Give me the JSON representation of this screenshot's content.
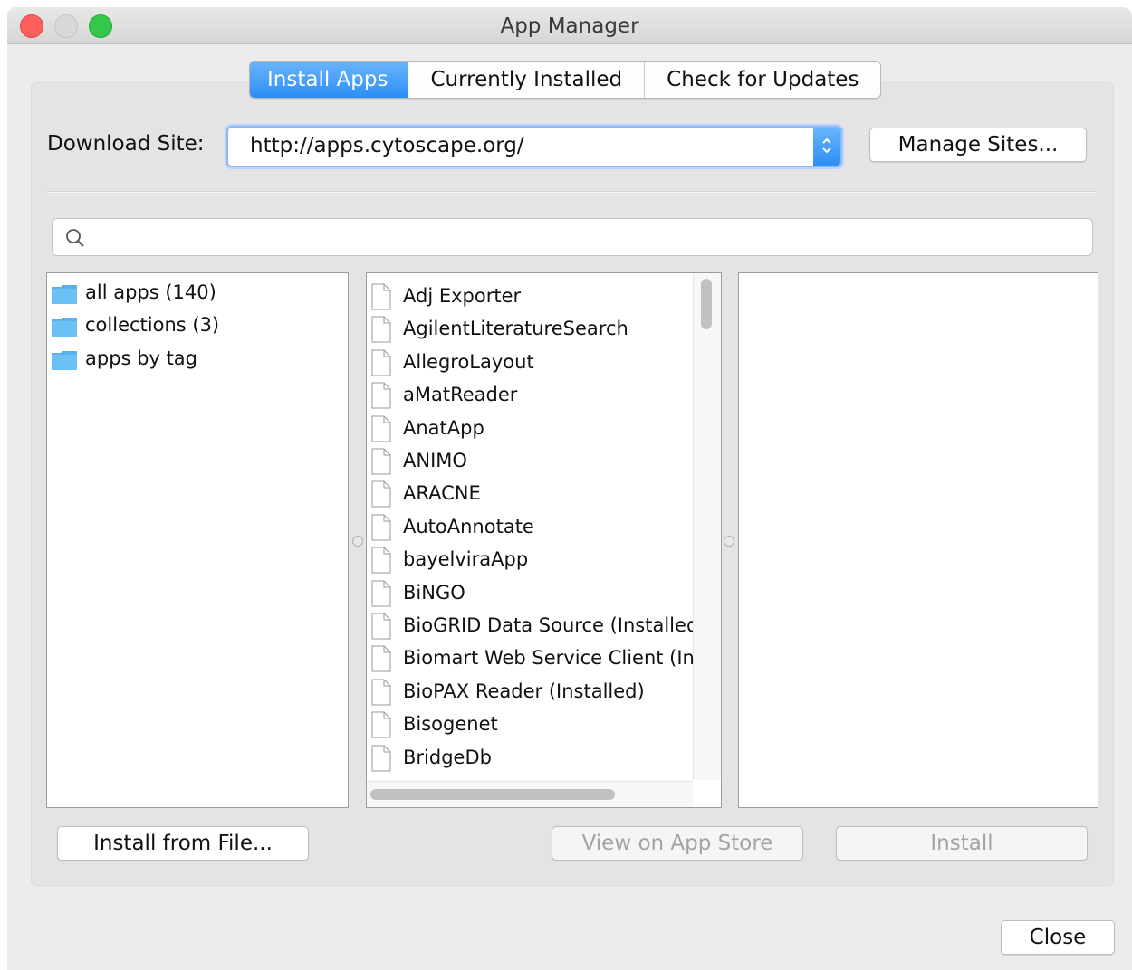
{
  "window": {
    "title": "App Manager"
  },
  "tabs": [
    {
      "label": "Install Apps",
      "active": true
    },
    {
      "label": "Currently Installed",
      "active": false
    },
    {
      "label": "Check for Updates",
      "active": false
    }
  ],
  "download_site": {
    "label": "Download Site:",
    "value": "http://apps.cytoscape.org/",
    "manage_label": "Manage Sites..."
  },
  "search": {
    "value": "",
    "icon": "search-icon"
  },
  "tree": [
    {
      "label": "all apps (140)",
      "icon": "folder-icon"
    },
    {
      "label": "collections (3)",
      "icon": "folder-icon"
    },
    {
      "label": "apps by tag",
      "icon": "folder-icon"
    }
  ],
  "apps": [
    "Adj Exporter",
    "AgilentLiteratureSearch",
    "AllegroLayout",
    "aMatReader",
    "AnatApp",
    "ANIMO",
    "ARACNE",
    "AutoAnnotate",
    "bayelviraApp",
    "BiNGO",
    "BioGRID Data Source (Installed)",
    "Biomart Web Service Client (Inst",
    "BioPAX Reader (Installed)",
    "Bisogenet",
    "BridgeDb"
  ],
  "buttons": {
    "install_from_file": "Install from File...",
    "view_on_app_store": "View on App Store",
    "install": "Install",
    "close": "Close"
  },
  "colors": {
    "accent": "#2d8ef5",
    "close_dot": "#fc605c",
    "max_dot": "#34c84a"
  }
}
